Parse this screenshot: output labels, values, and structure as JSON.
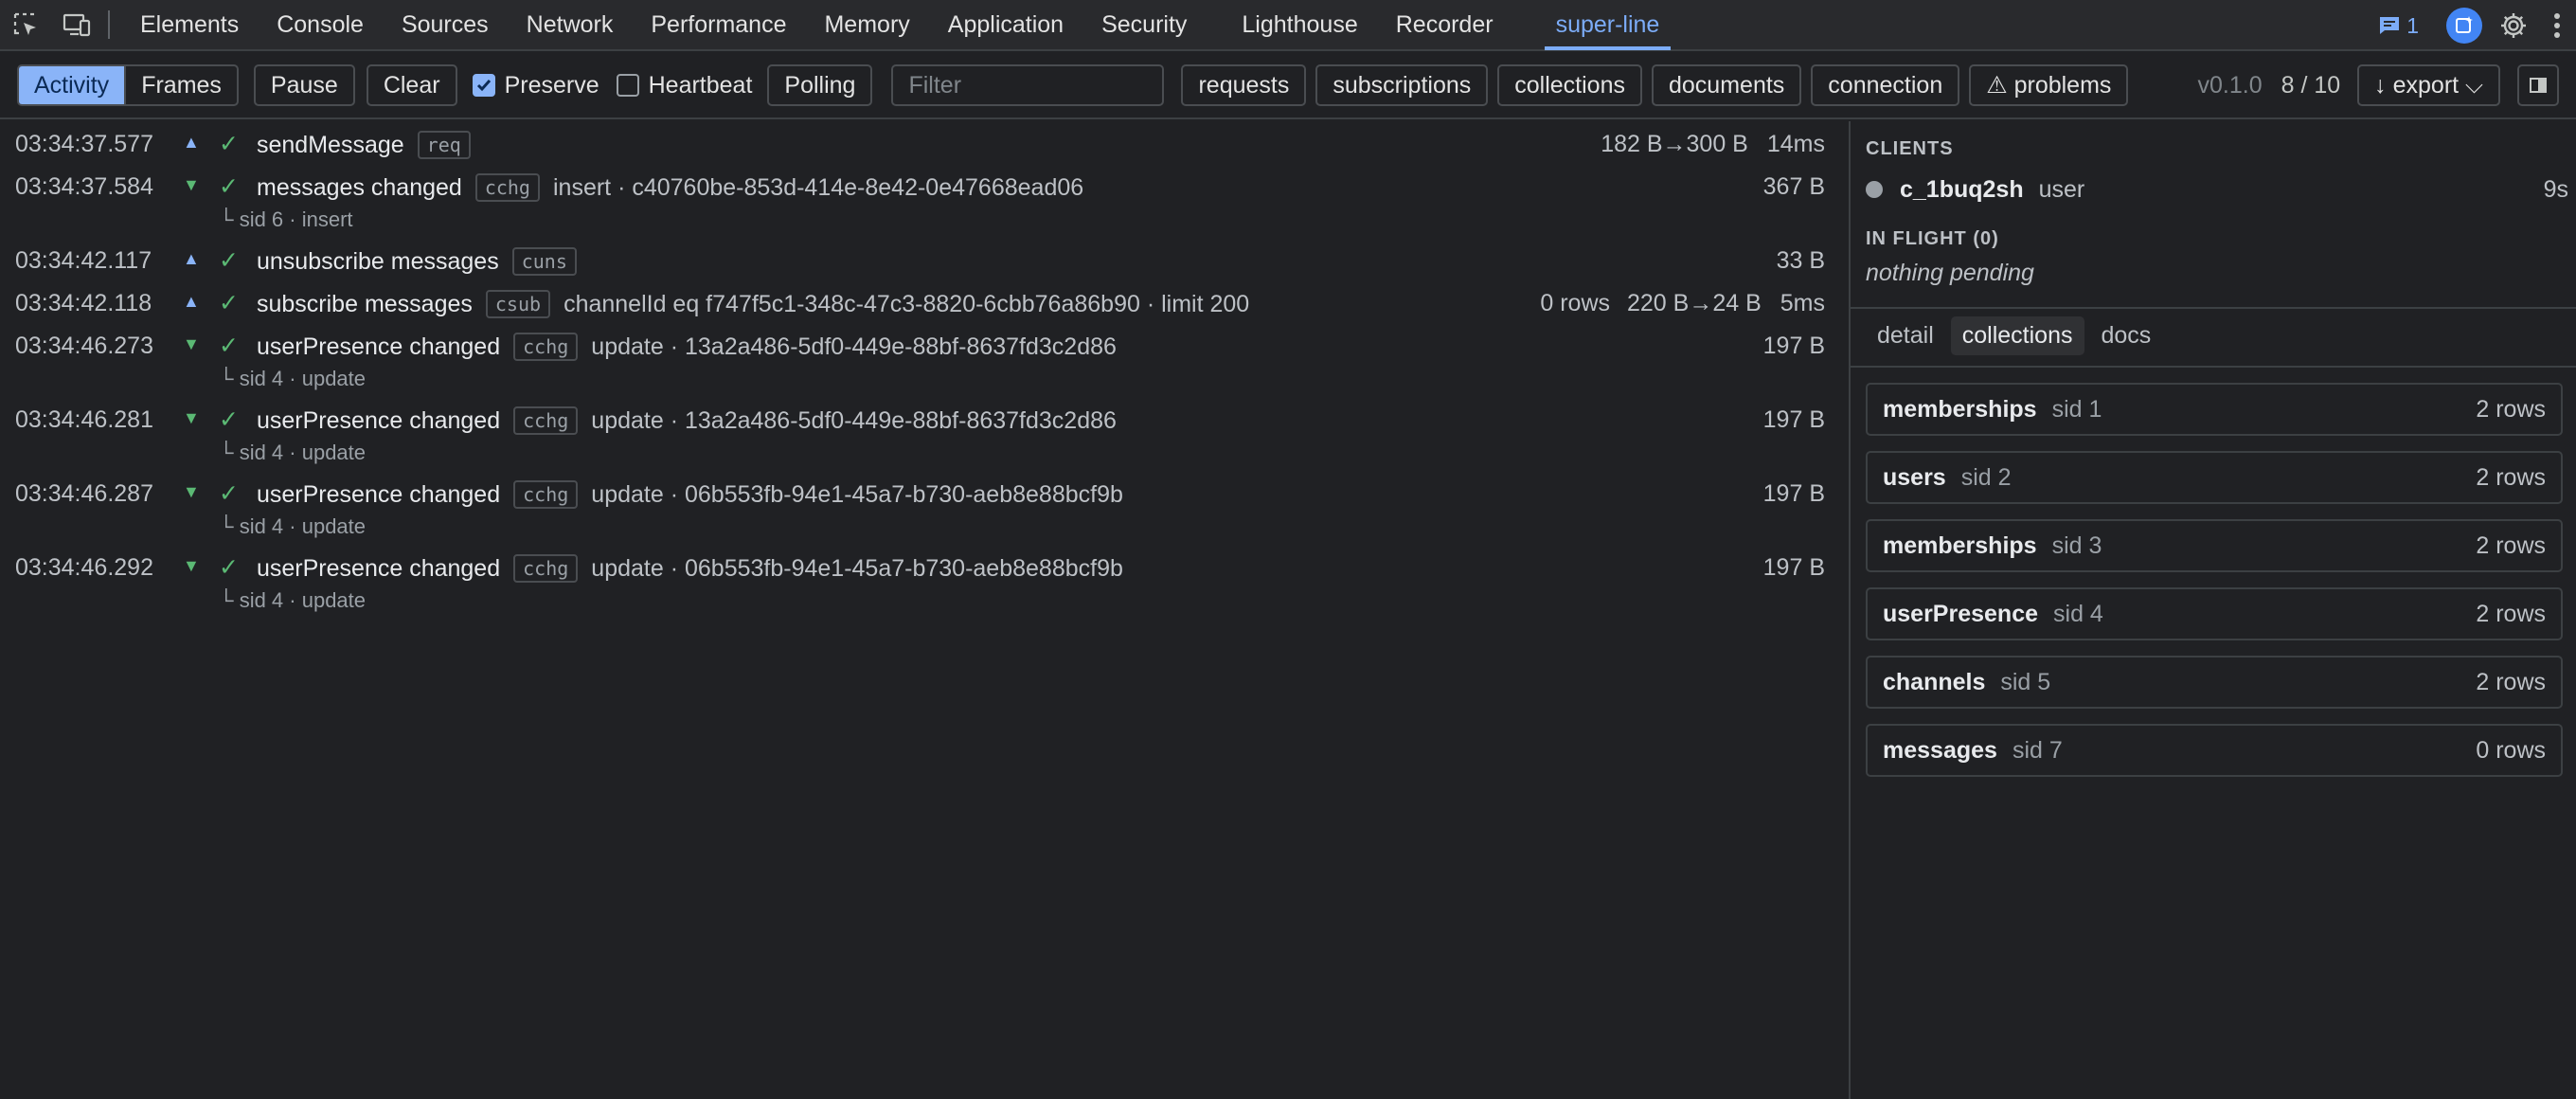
{
  "devtools": {
    "tabs": [
      {
        "label": "Elements"
      },
      {
        "label": "Console"
      },
      {
        "label": "Sources"
      },
      {
        "label": "Network"
      },
      {
        "label": "Performance"
      },
      {
        "label": "Memory"
      },
      {
        "label": "Application"
      },
      {
        "label": "Security"
      },
      {
        "label": "Lighthouse"
      },
      {
        "label": "Recorder"
      },
      {
        "label": "super-line"
      }
    ],
    "active_tab": "super-line",
    "issues_count": "1",
    "icons": [
      "inspect-element-icon",
      "device-toolbar-icon",
      "issues-icon",
      "ai-assistance-icon",
      "settings-gear-icon",
      "more-vert-icon"
    ],
    "accent_color": "#7cacf8"
  },
  "toolbar": {
    "view_segments": [
      {
        "label": "Activity"
      },
      {
        "label": "Frames"
      }
    ],
    "pause_label": "Pause",
    "clear_label": "Clear",
    "preserve": {
      "label": "Preserve",
      "checked": true
    },
    "heartbeat": {
      "label": "Heartbeat",
      "checked": false
    },
    "polling_label": "Polling",
    "filter_placeholder": "Filter",
    "filters": [
      {
        "label": "requests"
      },
      {
        "label": "subscriptions"
      },
      {
        "label": "collections"
      },
      {
        "label": "documents"
      },
      {
        "label": "connection"
      },
      {
        "label": "⚠ problems"
      }
    ],
    "version": "v0.1.0",
    "count": "8 / 10",
    "export_label": "↓ export ⌵"
  },
  "log": [
    {
      "time": "03:34:37.577",
      "dir": "▲",
      "check": "✓",
      "name": "sendMessage",
      "badge": "req",
      "detail": "",
      "rows": "",
      "size": "182 B→300 B",
      "dur": "14ms",
      "sub": ""
    },
    {
      "time": "03:34:37.584",
      "dir": "▼",
      "check": "✓",
      "name": "messages changed",
      "badge": "cchg",
      "detail": "insert · c40760be-853d-414e-8e42-0e47668ead06",
      "rows": "",
      "size": "367 B",
      "dur": "",
      "sub": "└ sid 6 · insert"
    },
    {
      "time": "03:34:42.117",
      "dir": "▲",
      "check": "✓",
      "name": "unsubscribe messages",
      "badge": "cuns",
      "detail": "",
      "rows": "",
      "size": "33 B",
      "dur": "",
      "sub": ""
    },
    {
      "time": "03:34:42.118",
      "dir": "▲",
      "check": "✓",
      "name": "subscribe messages",
      "badge": "csub",
      "detail": "channelId eq f747f5c1-348c-47c3-8820-6cbb76a86b90 · limit 200",
      "rows": "0 rows",
      "size": "220 B→24 B",
      "dur": "5ms",
      "sub": ""
    },
    {
      "time": "03:34:46.273",
      "dir": "▼",
      "check": "✓",
      "name": "userPresence changed",
      "badge": "cchg",
      "detail": "update · 13a2a486-5df0-449e-88bf-8637fd3c2d86",
      "rows": "",
      "size": "197 B",
      "dur": "",
      "sub": "└ sid 4 · update"
    },
    {
      "time": "03:34:46.281",
      "dir": "▼",
      "check": "✓",
      "name": "userPresence changed",
      "badge": "cchg",
      "detail": "update · 13a2a486-5df0-449e-88bf-8637fd3c2d86",
      "rows": "",
      "size": "197 B",
      "dur": "",
      "sub": "└ sid 4 · update"
    },
    {
      "time": "03:34:46.287",
      "dir": "▼",
      "check": "✓",
      "name": "userPresence changed",
      "badge": "cchg",
      "detail": "update · 06b553fb-94e1-45a7-b730-aeb8e88bcf9b",
      "rows": "",
      "size": "197 B",
      "dur": "",
      "sub": "└ sid 4 · update"
    },
    {
      "time": "03:34:46.292",
      "dir": "▼",
      "check": "✓",
      "name": "userPresence changed",
      "badge": "cchg",
      "detail": "update · 06b553fb-94e1-45a7-b730-aeb8e88bcf9b",
      "rows": "",
      "size": "197 B",
      "dur": "",
      "sub": "└ sid 4 · update"
    }
  ],
  "sidebar": {
    "clients_title": "CLIENTS",
    "client": {
      "id": "c_1buq2sh",
      "role": "user",
      "age": "9s"
    },
    "inflight_title": "IN FLIGHT (0)",
    "inflight_empty": "nothing pending",
    "tabs": [
      {
        "label": "detail"
      },
      {
        "label": "collections"
      },
      {
        "label": "docs"
      }
    ],
    "active_tab": "collections",
    "collections": [
      {
        "name": "memberships",
        "sid": "sid 1",
        "rows": "2 rows"
      },
      {
        "name": "users",
        "sid": "sid 2",
        "rows": "2 rows"
      },
      {
        "name": "memberships",
        "sid": "sid 3",
        "rows": "2 rows"
      },
      {
        "name": "userPresence",
        "sid": "sid 4",
        "rows": "2 rows"
      },
      {
        "name": "channels",
        "sid": "sid 5",
        "rows": "2 rows"
      },
      {
        "name": "messages",
        "sid": "sid 7",
        "rows": "0 rows"
      }
    ]
  }
}
